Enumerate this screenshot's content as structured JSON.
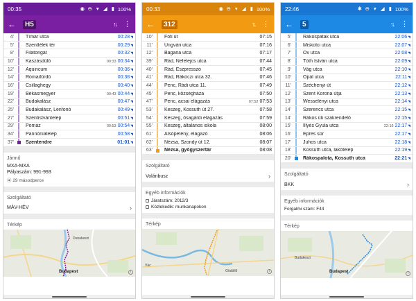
{
  "panels": [
    {
      "theme": {
        "bar": "#7b1fa2",
        "status": "#6a1b9a",
        "track": "#b388c9",
        "route_bg": "#4a1465"
      },
      "status_time": "00:35",
      "status_battery": "100%",
      "route": "H5",
      "stops": [
        {
          "min": "4'",
          "name": "Tímár utca",
          "time": "00:28",
          "orig": "",
          "rt": true
        },
        {
          "min": "5'",
          "name": "Szentlélek tér",
          "time": "00:29",
          "orig": "",
          "rt": true
        },
        {
          "min": "8'",
          "name": "Filatorigát",
          "time": "00:32",
          "orig": "",
          "rt": true
        },
        {
          "min": "10'",
          "name": "Kaszásdűlő",
          "time": "00:34",
          "orig": "00:33",
          "rt": true
        },
        {
          "min": "12'",
          "name": "Aquincum",
          "time": "00:36",
          "orig": "",
          "rt": true
        },
        {
          "min": "14'",
          "name": "Rómaifürdő",
          "time": "00:38",
          "orig": "",
          "rt": true
        },
        {
          "min": "16'",
          "name": "Csillaghegy",
          "time": "00:40",
          "orig": "",
          "rt": true
        },
        {
          "min": "19'",
          "name": "Békásmegyer",
          "time": "00:44",
          "orig": "00:43",
          "rt": true
        },
        {
          "min": "22'",
          "name": "Budakalász",
          "time": "00:47",
          "orig": "",
          "rt": true
        },
        {
          "min": "25'",
          "name": "Budakalász, Lenfonó",
          "time": "00:49",
          "orig": "",
          "rt": true
        },
        {
          "min": "27'",
          "name": "Szentistvántelep",
          "time": "00:51",
          "orig": "",
          "rt": true
        },
        {
          "min": "29'",
          "name": "Pomáz",
          "time": "00:54",
          "orig": "00:53",
          "rt": true
        },
        {
          "min": "34'",
          "name": "Pannóniatelep",
          "time": "00:58",
          "orig": "",
          "rt": true
        },
        {
          "min": "37'",
          "name": "Szentendre",
          "time": "01:01",
          "orig": "",
          "rt": true,
          "last": true
        }
      ],
      "vehicle_title": "Jármű",
      "vehicle_name": "MXA-MXA",
      "vehicle_plate": "Pályaszám: 991-993",
      "vehicle_age": "29 másodperce",
      "operator_title": "Szolgáltató",
      "operator_name": "MÁV-HÉV",
      "map_title": "Térkép",
      "map_labels": [
        "Dunakeszi",
        "Budapest"
      ]
    },
    {
      "theme": {
        "bar": "#f29a12",
        "status": "#d9840a",
        "track": "#f6c36f",
        "route_bg": "#c76c00"
      },
      "status_time": "00:33",
      "status_battery": "100%",
      "route": "312",
      "stops": [
        {
          "min": "10'",
          "name": "Fóti út",
          "time": "07:15",
          "orig": "",
          "rt": false
        },
        {
          "min": "11'",
          "name": "Ungvári utca",
          "time": "07:16",
          "orig": "",
          "rt": false
        },
        {
          "min": "12'",
          "name": "Bagaria utca",
          "time": "07:17",
          "orig": "",
          "rt": false
        },
        {
          "min": "39'",
          "name": "Rád, Nefelejcs utca",
          "time": "07:44",
          "orig": "",
          "rt": false
        },
        {
          "min": "40'",
          "name": "Rád, Eszpresszó",
          "time": "07:45",
          "orig": "",
          "rt": false
        },
        {
          "min": "41'",
          "name": "Rád, Rákóczi utca 32.",
          "time": "07:46",
          "orig": "",
          "rt": false
        },
        {
          "min": "44'",
          "name": "Penc, Rádi utca 11.",
          "time": "07:49",
          "orig": "",
          "rt": false
        },
        {
          "min": "45'",
          "name": "Penc, községháza",
          "time": "07:50",
          "orig": "",
          "rt": false
        },
        {
          "min": "47'",
          "name": "Penc, acsai elágazás",
          "time": "07:53",
          "orig": "07:52",
          "rt": false
        },
        {
          "min": "53'",
          "name": "Keszeg, Kossuth út 27.",
          "time": "07:58",
          "orig": "",
          "rt": false
        },
        {
          "min": "54'",
          "name": "Keszeg, ösagárdi elágazás",
          "time": "07:59",
          "orig": "",
          "rt": false
        },
        {
          "min": "55'",
          "name": "Keszeg, általános iskola",
          "time": "08:00",
          "orig": "",
          "rt": false
        },
        {
          "min": "61'",
          "name": "Alsópetény, elágazó",
          "time": "08:06",
          "orig": "",
          "rt": false
        },
        {
          "min": "62'",
          "name": "Nézsa, Szondy út 12.",
          "time": "08:07",
          "orig": "",
          "rt": false
        },
        {
          "min": "63'",
          "name": "Nézsa, gyógyszertár",
          "time": "08:08",
          "orig": "",
          "rt": false,
          "last": true
        }
      ],
      "operator_title": "Szolgáltató",
      "operator_name": "Volánbusz",
      "info_title": "Egyéb információk",
      "info_lines": [
        "Járatszám: 2012/3",
        "Közlekedik: munkanapokon"
      ],
      "map_title": "Térkép",
      "map_labels": [
        "Vác",
        "Gödöllő"
      ]
    },
    {
      "theme": {
        "bar": "#1e88e5",
        "status": "#1976d2",
        "track": "#90c3f0",
        "route_bg": "#0d5aa7"
      },
      "status_time": "22:46",
      "status_battery": "100%",
      "route": "5",
      "stops": [
        {
          "min": "5'",
          "name": "Rákospatak utca",
          "time": "22:06",
          "orig": "",
          "rt": true
        },
        {
          "min": "6'",
          "name": "Miskolci utca",
          "time": "22:07",
          "orig": "",
          "rt": true
        },
        {
          "min": "7'",
          "name": "Öv utca",
          "time": "22:08",
          "orig": "",
          "rt": true
        },
        {
          "min": "8'",
          "name": "Tóth István utca",
          "time": "22:09",
          "orig": "",
          "rt": true
        },
        {
          "min": "9'",
          "name": "Vág utca",
          "time": "22:10",
          "orig": "",
          "rt": true
        },
        {
          "min": "10'",
          "name": "Opál utca",
          "time": "22:11",
          "orig": "",
          "rt": true
        },
        {
          "min": "11'",
          "name": "Széchenyi út",
          "time": "22:12",
          "orig": "",
          "rt": true
        },
        {
          "min": "12'",
          "name": "Szent Korona útja",
          "time": "22:13",
          "orig": "",
          "rt": true
        },
        {
          "min": "13'",
          "name": "Wesselényi utca",
          "time": "22:14",
          "orig": "",
          "rt": true
        },
        {
          "min": "14'",
          "name": "Szerencs utca",
          "time": "22:15",
          "orig": "",
          "rt": true
        },
        {
          "min": "14'",
          "name": "Rákos úti szakrendelő",
          "time": "22:15",
          "orig": "",
          "rt": true
        },
        {
          "min": "15'",
          "name": "Illyés Gyula utca",
          "time": "22:17",
          "orig": "22:16",
          "rt": true
        },
        {
          "min": "16'",
          "name": "Epres sor",
          "time": "22:17",
          "orig": "",
          "rt": true
        },
        {
          "min": "17'",
          "name": "Juhos utca",
          "time": "22:18",
          "orig": "",
          "rt": true
        },
        {
          "min": "18'",
          "name": "Kossuth utca, lakótelep",
          "time": "22:19",
          "orig": "",
          "rt": true
        },
        {
          "min": "20'",
          "name": "Rákospalota, Kossuth utca",
          "time": "22:21",
          "orig": "",
          "rt": true,
          "last": true
        }
      ],
      "operator_title": "Szolgáltató",
      "operator_name": "BKK",
      "info_title": "Egyéb információk",
      "info_lines": [
        "Forgalmi szám: F44"
      ],
      "map_title": "Térkép",
      "map_labels": [
        "Budakeszi",
        "Budapest"
      ]
    }
  ]
}
